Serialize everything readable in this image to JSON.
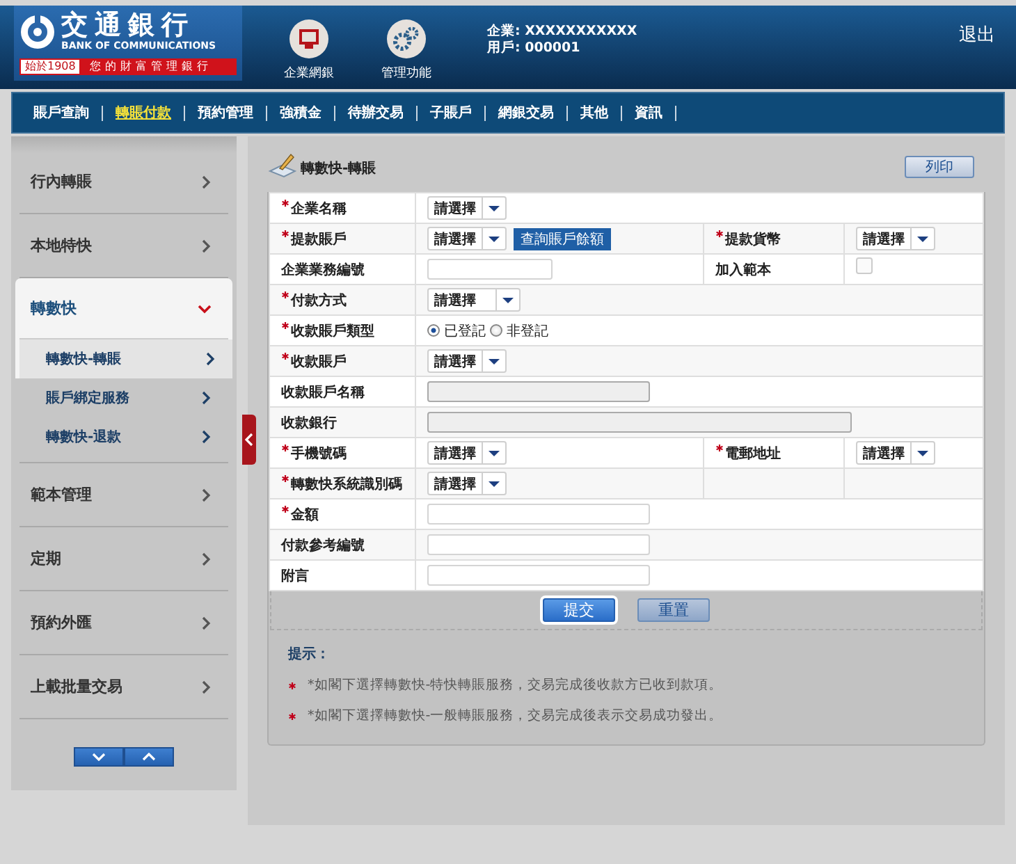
{
  "header": {
    "logo": {
      "name_zh": "交通銀行",
      "name_en": "BANK OF COMMUNICATIONS",
      "since": "始於1908",
      "slogan": "您的財富管理銀行"
    },
    "shortcuts": [
      {
        "label": "企業網銀",
        "kind": "monitor"
      },
      {
        "label": "管理功能",
        "kind": "gears"
      }
    ],
    "company": "企業: XXXXXXXXXXX",
    "user": "用戶: 000001",
    "logout": "退出"
  },
  "nav": [
    {
      "label": "賬戶查詢",
      "selected": false
    },
    {
      "label": "轉賬付款",
      "selected": true
    },
    {
      "label": "預約管理",
      "selected": false
    },
    {
      "label": "強積金",
      "selected": false
    },
    {
      "label": "待辦交易",
      "selected": false
    },
    {
      "label": "子賬戶",
      "selected": false
    },
    {
      "label": "網銀交易",
      "selected": false
    },
    {
      "label": "其他",
      "selected": false
    },
    {
      "label": "資訊",
      "selected": false
    }
  ],
  "sidebar": {
    "items": [
      {
        "label": "行內轉賬",
        "expanded": false
      },
      {
        "label": "本地特快",
        "expanded": false
      },
      {
        "label": "轉數快",
        "expanded": true,
        "children": [
          {
            "label": "轉數快-轉賬",
            "selected": true
          },
          {
            "label": "賬戶綁定服務",
            "selected": false
          },
          {
            "label": "轉數快-退款",
            "selected": false
          }
        ]
      },
      {
        "label": "範本管理",
        "expanded": false
      },
      {
        "label": "定期",
        "expanded": false
      },
      {
        "label": "預約外匯",
        "expanded": false
      },
      {
        "label": "上載批量交易",
        "expanded": false
      }
    ]
  },
  "page": {
    "title": "轉數快-轉賬",
    "print_button": "列印"
  },
  "form": {
    "rows": [
      {
        "fields": [
          {
            "label": "企業名稱",
            "required": true,
            "control": {
              "kind": "select",
              "value": "請選擇"
            }
          }
        ]
      },
      {
        "fields": [
          {
            "label": "提款賬戶",
            "required": true,
            "control": {
              "kind": "select",
              "value": "請選擇",
              "button": "查詢賬戶餘額"
            }
          },
          {
            "label": "提款貨幣",
            "required": true,
            "control": {
              "kind": "select",
              "value": "請選擇"
            }
          }
        ]
      },
      {
        "fields": [
          {
            "label": "企業業務編號",
            "required": false,
            "control": {
              "kind": "input",
              "disabled": false
            }
          },
          {
            "label": "加入範本",
            "required": false,
            "control": {
              "kind": "checkbox",
              "checked": false
            }
          }
        ]
      },
      {
        "fields": [
          {
            "label": "付款方式",
            "required": true,
            "control": {
              "kind": "select_wide",
              "value": "請選擇"
            }
          }
        ]
      },
      {
        "fields": [
          {
            "label": "收款賬戶類型",
            "required": true,
            "control": {
              "kind": "radio",
              "options": [
                {
                  "label": "已登記",
                  "selected": true
                },
                {
                  "label": "非登記",
                  "selected": false
                }
              ]
            }
          }
        ]
      },
      {
        "fields": [
          {
            "label": "收款賬戶",
            "required": true,
            "control": {
              "kind": "select",
              "value": "請選擇"
            }
          }
        ]
      },
      {
        "fields": [
          {
            "label": "收款賬戶名稱",
            "required": false,
            "control": {
              "kind": "input",
              "disabled": true
            }
          }
        ]
      },
      {
        "fields": [
          {
            "label": "收款銀行",
            "required": false,
            "control": {
              "kind": "input_wide",
              "disabled": true
            }
          }
        ]
      },
      {
        "fields": [
          {
            "label": "手機號碼",
            "required": true,
            "control": {
              "kind": "select",
              "value": "請選擇"
            }
          },
          {
            "label": "電郵地址",
            "required": true,
            "control": {
              "kind": "select",
              "value": "請選擇"
            }
          }
        ]
      },
      {
        "fields": [
          {
            "label": "轉數快系統識別碼",
            "required": true,
            "control": {
              "kind": "select",
              "value": "請選擇"
            }
          },
          {
            "kind": "empty"
          }
        ]
      },
      {
        "fields": [
          {
            "label": "金額",
            "required": true,
            "control": {
              "kind": "input",
              "disabled": false
            }
          }
        ]
      },
      {
        "fields": [
          {
            "label": "付款參考編號",
            "required": false,
            "control": {
              "kind": "input",
              "disabled": false
            }
          }
        ]
      },
      {
        "fields": [
          {
            "label": "附言",
            "required": false,
            "control": {
              "kind": "input",
              "disabled": false
            }
          }
        ]
      }
    ],
    "buttons": [
      {
        "label": "提交",
        "kind": "primary"
      },
      {
        "label": "重置",
        "kind": "secondary"
      }
    ]
  },
  "tips": {
    "title": "提示：",
    "notes": [
      "*如閣下選擇轉數快-特快轉賬服務，交易完成後收款方已收到款項。",
      "*如閣下選擇轉數快-一般轉賬服務，交易完成後表示交易成功發出。"
    ]
  }
}
